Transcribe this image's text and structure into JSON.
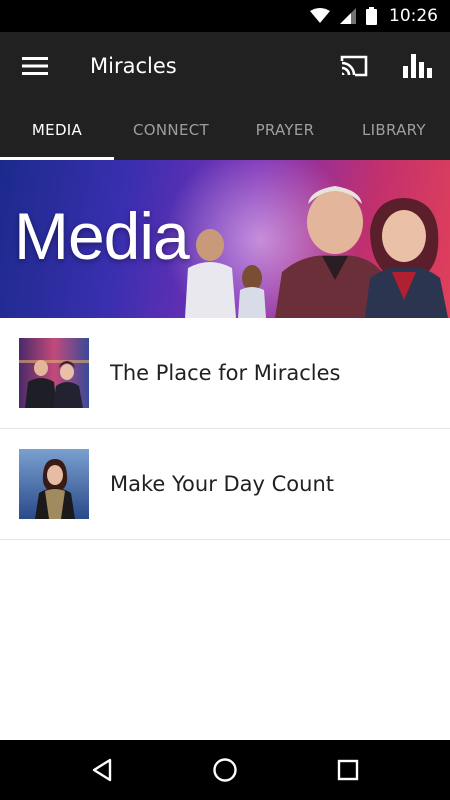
{
  "status_bar": {
    "time": "10:26",
    "icons": [
      "wifi-icon",
      "cell-signal-icon",
      "battery-icon"
    ]
  },
  "app_bar": {
    "title": "Miracles",
    "icons": [
      "menu-icon",
      "cast-icon",
      "bar-chart-icon"
    ]
  },
  "tabs": [
    {
      "label": "MEDIA",
      "active": true
    },
    {
      "label": "CONNECT",
      "active": false
    },
    {
      "label": "PRAYER",
      "active": false
    },
    {
      "label": "LIBRARY",
      "active": false
    }
  ],
  "banner": {
    "title": "Media"
  },
  "list": {
    "items": [
      {
        "label": "The Place for Miracles",
        "thumbnail": "couple-thumbnail"
      },
      {
        "label": "Make Your Day Count",
        "thumbnail": "woman-thumbnail"
      }
    ]
  },
  "nav_bar": {
    "icons": [
      "back-icon",
      "home-icon",
      "recents-icon"
    ]
  },
  "colors": {
    "status_bar": "#000000",
    "app_bar": "#212121",
    "tab_active": "#ffffff",
    "tab_inactive": "#9e9e9e",
    "text": "#212121"
  }
}
